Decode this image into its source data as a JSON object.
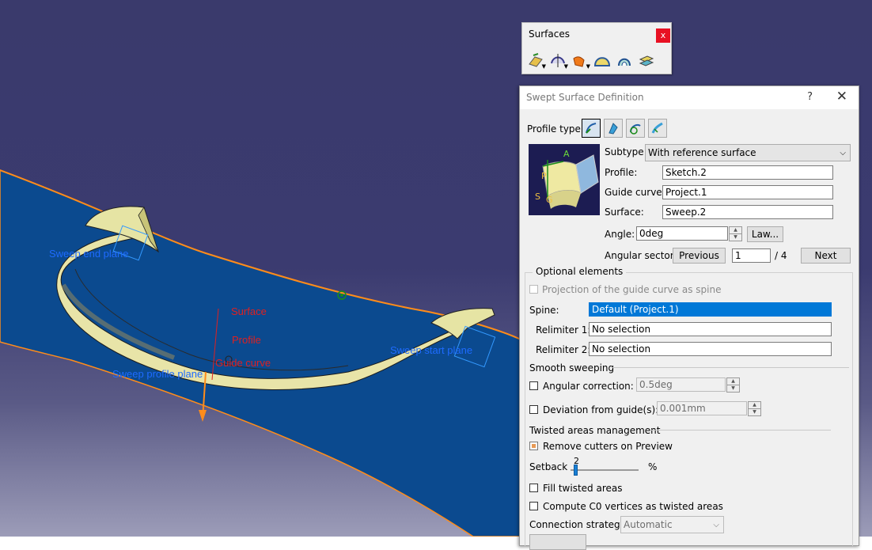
{
  "viewport": {
    "labels": {
      "sweep_end_plane": "Sweep end plane",
      "sweep_start_plane": "Sweep start plane",
      "sweep_profile_plane": "Sweep profile plane",
      "surface": "Surface",
      "profile": "Profile",
      "guide_curve": "Guide curve"
    },
    "colors": {
      "label_blue": "#1e6bff",
      "label_red": "#e02020",
      "surface_fill": "#0b4a8f",
      "edge": "#ff8c1a"
    }
  },
  "toolbar": {
    "title": "Surfaces",
    "close": "x",
    "icons": [
      "extrude-icon",
      "revolve-icon",
      "sweep-icon",
      "fill-icon",
      "blend-icon",
      "offset-icon"
    ]
  },
  "dialog": {
    "title": "Swept Surface Definition",
    "help": "?",
    "close": "✕",
    "profile_type_label": "Profile type:",
    "profile_types": [
      "explicit-icon",
      "line-icon",
      "circle-icon",
      "conic-icon"
    ],
    "subtype_label": "Subtype:",
    "subtype_value": "With reference surface",
    "preview_labels": {
      "a": "A",
      "p": "P",
      "s": "S",
      "g": "G"
    },
    "profile_label": "Profile:",
    "profile_value": "Sketch.2",
    "guide_label": "Guide curve:",
    "guide_value": "Project.1",
    "surface_label": "Surface:",
    "surface_value": "Sweep.2",
    "angle_label": "Angle:",
    "angle_value": "0deg",
    "law_button": "Law...",
    "sector_label": "Angular sector:",
    "previous_button": "Previous",
    "sector_value": "1",
    "sector_total": "/ 4",
    "next_button": "Next",
    "optional_title": "Optional elements",
    "projection_label": "Projection of the guide curve as spine",
    "spine_label": "Spine:",
    "spine_value": "Default (Project.1)",
    "relim1_label": "Relimiter 1:",
    "relim1_value": "No selection",
    "relim2_label": "Relimiter 2:",
    "relim2_value": "No selection",
    "smooth_title": "Smooth sweeping",
    "angular_corr_label": "Angular correction:",
    "angular_corr_value": "0.5deg",
    "deviation_label": "Deviation from guide(s):",
    "deviation_value": "0.001mm",
    "twisted_title": "Twisted areas management",
    "remove_cutters_label": "Remove cutters on Preview",
    "setback_label": "Setback",
    "setback_value": "2",
    "setback_unit": "%",
    "fill_twisted_label": "Fill twisted areas",
    "compute_c0_label": "Compute C0 vertices as twisted areas",
    "connection_label": "Connection strategy:",
    "connection_value": "Automatic"
  }
}
